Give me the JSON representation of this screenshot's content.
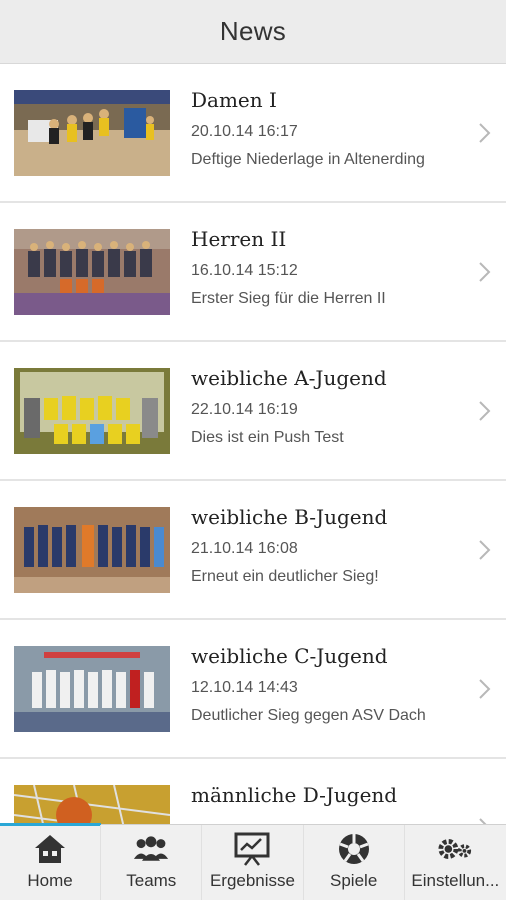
{
  "header": {
    "title": "News"
  },
  "news": [
    {
      "title": "Damen I",
      "date": "20.10.14 16:17",
      "description": "Deftige Niederlage in Altenerding"
    },
    {
      "title": "Herren II",
      "date": "16.10.14 15:12",
      "description": "Erster Sieg für die Herren II"
    },
    {
      "title": "weibliche A-Jugend",
      "date": "22.10.14 16:19",
      "description": "Dies ist ein Push Test"
    },
    {
      "title": "weibliche B-Jugend",
      "date": "21.10.14 16:08",
      "description": "Erneut ein deutlicher Sieg!"
    },
    {
      "title": "weibliche C-Jugend",
      "date": "12.10.14 14:43",
      "description": "Deutlicher Sieg gegen ASV Dach"
    },
    {
      "title": "männliche D-Jugend",
      "date": "",
      "description": ""
    }
  ],
  "tabs": [
    {
      "label": "Home",
      "icon": "house-icon",
      "active": true
    },
    {
      "label": "Teams",
      "icon": "people-icon",
      "active": false
    },
    {
      "label": "Ergebnisse",
      "icon": "presentation-chart-icon",
      "active": false
    },
    {
      "label": "Spiele",
      "icon": "ball-icon",
      "active": false
    },
    {
      "label": "Einstellun...",
      "icon": "gears-icon",
      "active": false
    }
  ],
  "colors": {
    "accent": "#2aa7d6",
    "header_bg": "#ececec",
    "tabbar_bg": "#f0f0f0"
  }
}
